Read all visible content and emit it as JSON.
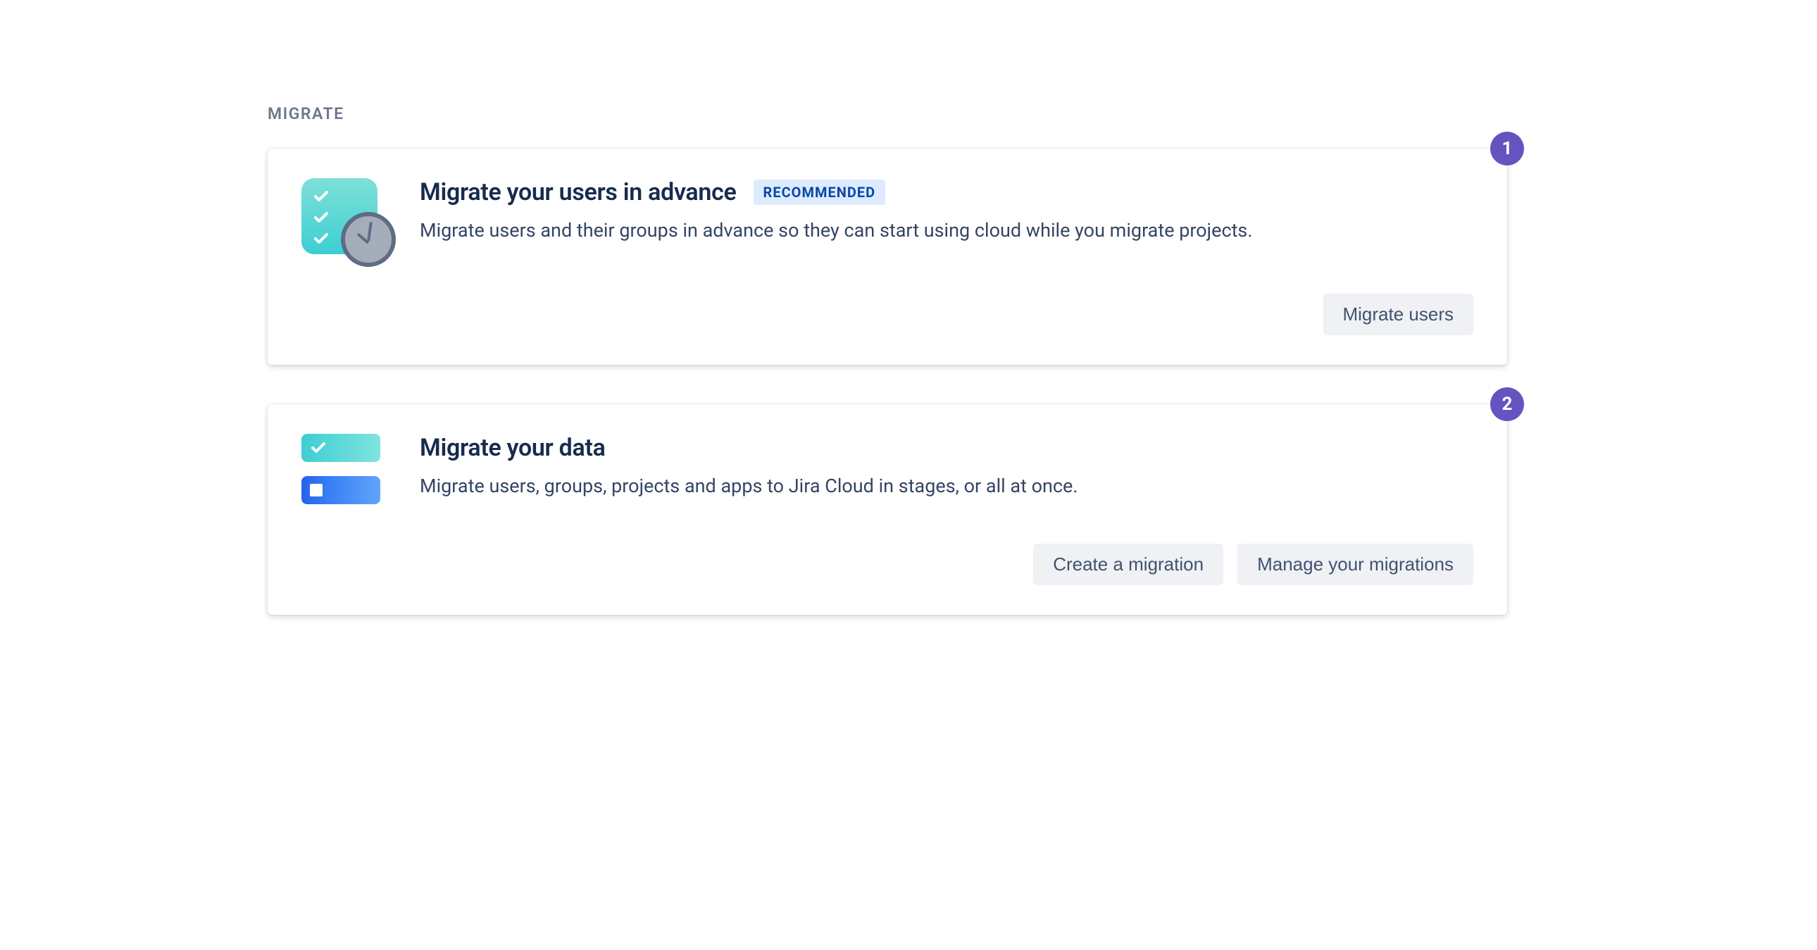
{
  "section_label": "MIGRATE",
  "cards": [
    {
      "step": "1",
      "title": "Migrate your users in advance",
      "badge": "RECOMMENDED",
      "description": "Migrate users and their groups in advance so they can start using cloud while you migrate projects.",
      "buttons": [
        "Migrate users"
      ]
    },
    {
      "step": "2",
      "title": "Migrate your data",
      "badge": "",
      "description": "Migrate users, groups, projects and apps to Jira Cloud in stages, or all at once.",
      "buttons": [
        "Create a migration",
        "Manage your migrations"
      ]
    }
  ]
}
